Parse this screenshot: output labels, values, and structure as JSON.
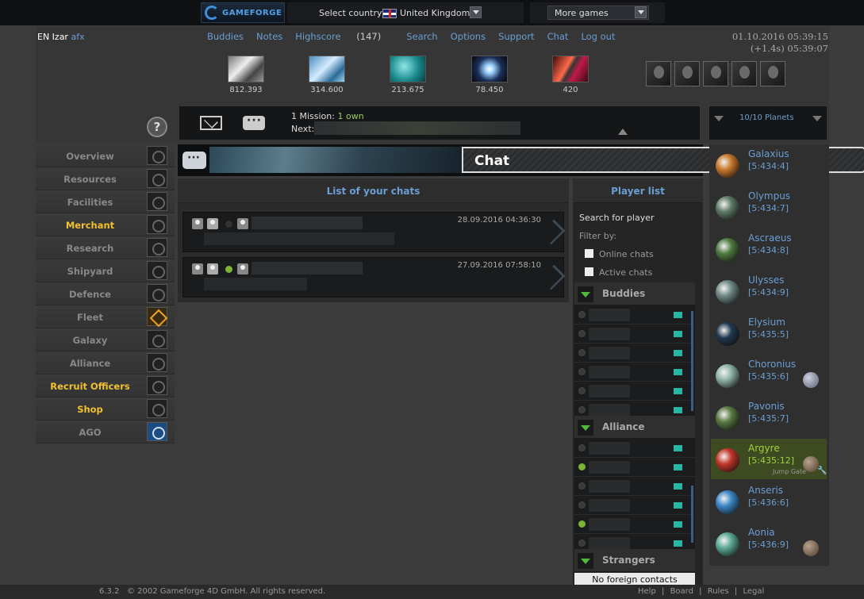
{
  "topbar": {
    "logo_text": "GAMEFORGE",
    "country_label": "Select country:",
    "country_value": "United Kingdom",
    "more_games": "More games"
  },
  "header": {
    "player_prefix": "EN Izar",
    "player_status": "afx",
    "nav": [
      {
        "label": "Buddies"
      },
      {
        "label": "Notes"
      },
      {
        "label": "Highscore",
        "count": "(147)"
      },
      {
        "label": "Search"
      },
      {
        "label": "Options"
      },
      {
        "label": "Support"
      },
      {
        "label": "Chat"
      },
      {
        "label": "Log out"
      }
    ],
    "datetime": "01.10.2016 05:39:15",
    "offset_time": "(+1.4s) 05:39:07"
  },
  "resources": [
    {
      "name": "metal",
      "value": "812.393"
    },
    {
      "name": "crystal",
      "value": "314.600"
    },
    {
      "name": "deuterium",
      "value": "213.675"
    },
    {
      "name": "energy",
      "value": "78.450"
    },
    {
      "name": "dark-matter",
      "value": "420"
    }
  ],
  "messages": {
    "mission_count": "1 Mission:",
    "mission_own": "1 own",
    "next_label": "Next:"
  },
  "planets_header": {
    "count": "10/10 Planets"
  },
  "menu": [
    {
      "label": "Overview",
      "icon": "overview-icon",
      "premium": false
    },
    {
      "label": "Resources",
      "icon": "resources-icon",
      "premium": false
    },
    {
      "label": "Facilities",
      "icon": "facilities-icon",
      "premium": false
    },
    {
      "label": "Merchant",
      "icon": "merchant-icon",
      "premium": true
    },
    {
      "label": "Research",
      "icon": "research-icon",
      "premium": false
    },
    {
      "label": "Shipyard",
      "icon": "shipyard-icon",
      "premium": false
    },
    {
      "label": "Defence",
      "icon": "defence-icon",
      "premium": false
    },
    {
      "label": "Fleet",
      "icon": "fleet-icon",
      "premium": false
    },
    {
      "label": "Galaxy",
      "icon": "galaxy-icon",
      "premium": false
    },
    {
      "label": "Alliance",
      "icon": "alliance-icon",
      "premium": false
    },
    {
      "label": "Recruit Officers",
      "icon": "officers-icon",
      "premium": true
    },
    {
      "label": "Shop",
      "icon": "shop-icon",
      "premium": true
    },
    {
      "label": "AGO",
      "icon": "ago-icon",
      "premium": false
    }
  ],
  "chat": {
    "title": "Chat",
    "list_title": "List of your chats",
    "entries": [
      {
        "timestamp": "28.09.2016 04:36:30",
        "online": false
      },
      {
        "timestamp": "27.09.2016 07:58:10",
        "online": true
      }
    ]
  },
  "player_list": {
    "title": "Player list",
    "search": "Search for player",
    "filter_by": "Filter by:",
    "online_chats": "Online chats",
    "active_chats": "Active chats",
    "buddies": "Buddies",
    "alliance": "Alliance",
    "strangers": "Strangers",
    "no_contacts": "No foreign contacts",
    "buddy_online": [
      false,
      false,
      false,
      false,
      false,
      false
    ],
    "alliance_online": [
      false,
      true,
      false,
      false,
      true,
      false
    ]
  },
  "planets": [
    {
      "name": "Galaxius",
      "coords": "[5:434:4]",
      "color": "#c8782c",
      "moon": ""
    },
    {
      "name": "Olympus",
      "coords": "[5:434:7]",
      "color": "#5f7a68",
      "moon": ""
    },
    {
      "name": "Ascraeus",
      "coords": "[5:434:8]",
      "color": "#4f7a40",
      "moon": ""
    },
    {
      "name": "Ulysses",
      "coords": "[5:434:9]",
      "color": "#6f8a86",
      "moon": ""
    },
    {
      "name": "Elysium",
      "coords": "[5:435:5]",
      "color": "#22384e",
      "moon": ""
    },
    {
      "name": "Choronius",
      "coords": "[5:435:6]",
      "color": "#8fb3a7",
      "moon": "blue"
    },
    {
      "name": "Pavonis",
      "coords": "[5:435:7]",
      "color": "#5a7a42",
      "moon": ""
    },
    {
      "name": "Argyre",
      "coords": "[5:435:12]",
      "color": "#c2372a",
      "moon": "brown",
      "active": true,
      "extra": "Jump Gate"
    },
    {
      "name": "Anseris",
      "coords": "[5:436:6]",
      "color": "#3c86c6",
      "moon": ""
    },
    {
      "name": "Aonia",
      "coords": "[5:436:9]",
      "color": "#5ca894",
      "moon": "brown"
    }
  ],
  "footer": {
    "version": "6.3.2",
    "copyright": "© 2002 Gameforge 4D GmbH. All rights reserved.",
    "links": [
      "Help",
      "|",
      "Board",
      "|",
      "Rules",
      "|",
      "Legal"
    ]
  }
}
